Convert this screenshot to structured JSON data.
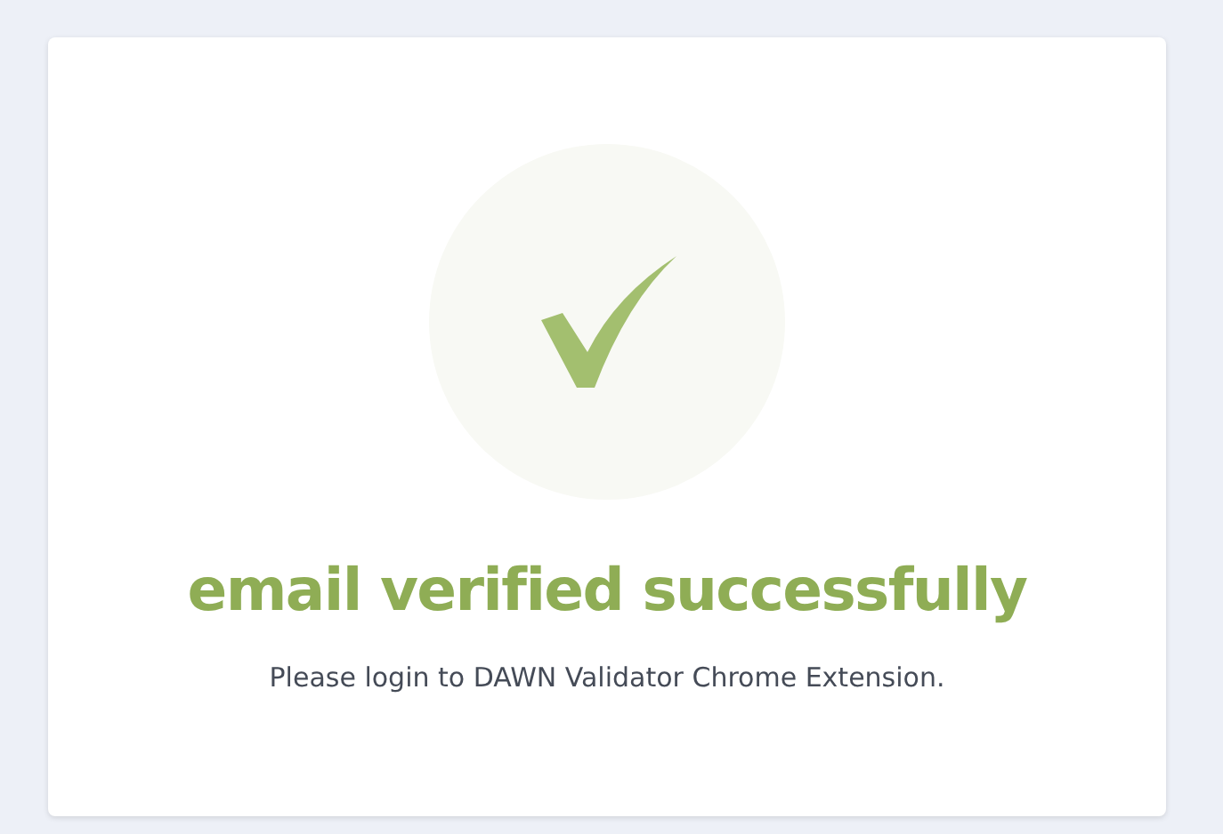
{
  "card": {
    "title": "email verified successfully",
    "message": "Please login to DAWN Validator Chrome Extension."
  }
}
